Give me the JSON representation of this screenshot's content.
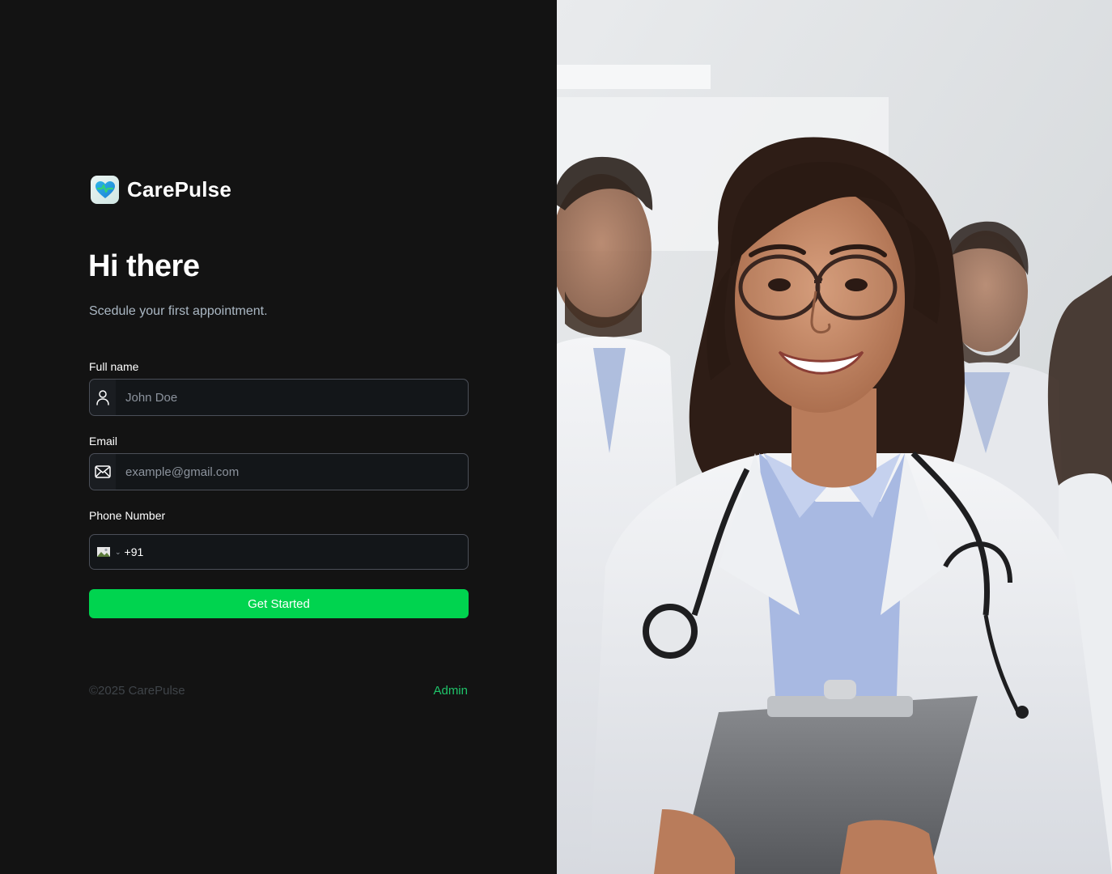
{
  "brand": {
    "name": "CarePulse",
    "logo_icon": "heart-pulse-icon",
    "accent": "#00d44f"
  },
  "heading": {
    "title": "Hi there",
    "subtitle": "Scedule your first appointment."
  },
  "form": {
    "full_name": {
      "label": "Full name",
      "placeholder": "John Doe",
      "icon": "user-icon"
    },
    "email": {
      "label": "Email",
      "placeholder": "example@gmail.com",
      "icon": "mail-icon"
    },
    "phone": {
      "label": "Phone Number",
      "country_code": "+91",
      "icon": "flag-icon"
    },
    "submit_label": "Get Started"
  },
  "footer": {
    "copyright": "©2025 CarePulse",
    "admin_link": "Admin"
  },
  "hero_image": {
    "subject": "smiling-doctor-photo"
  }
}
